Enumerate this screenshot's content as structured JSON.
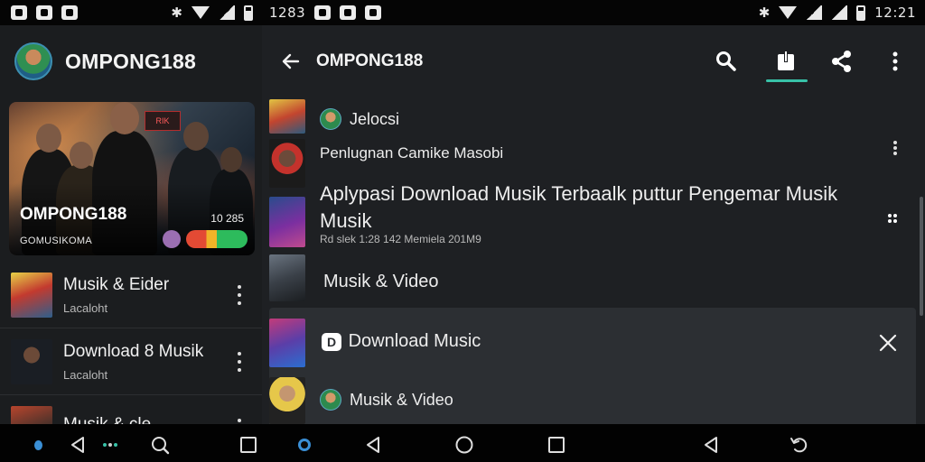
{
  "status_left": {
    "icons": [
      "notification-icon",
      "gallery-icon",
      "app-icon"
    ]
  },
  "status_right": {
    "time": "1283",
    "clock": "12:21",
    "icons": [
      "bluetooth-icon",
      "wifi-icon",
      "signal-icon",
      "battery-icon"
    ]
  },
  "left_panel": {
    "title": "OMPONG188",
    "hero": {
      "title": "OMPONG188",
      "subtitle": "GOMUSIKOMA",
      "count": "10 285",
      "sign_text": "RIK"
    },
    "items": [
      {
        "title": "Musik & Eider",
        "subtitle": "Lacaloht"
      },
      {
        "title": "Download 8 Musik",
        "subtitle": "Lacaloht"
      },
      {
        "title": "Musik & cle",
        "subtitle": ""
      }
    ]
  },
  "right_panel": {
    "title": "OMPONG188",
    "rows": [
      {
        "label": "Jelocsi"
      },
      {
        "label": "Penlugnan Camike Masobi"
      },
      {
        "label_line1": "Aplypasi Download Musik Terbaalk puttur Pengemar Musik",
        "label_line2": "Musik",
        "meta": "Rd slek 1:28 142 Memiela 201M9"
      },
      {
        "label": "Musik & Video"
      }
    ],
    "card": {
      "title": "Download Music",
      "title_mark": "D",
      "row_label": "Musik & Video"
    }
  },
  "colors": {
    "accent": "#38c2a8",
    "panel": "#1b1d1f",
    "panel_right": "#1e2023",
    "card": "#2c2f33",
    "nav_dot": "#3a8fd6"
  }
}
